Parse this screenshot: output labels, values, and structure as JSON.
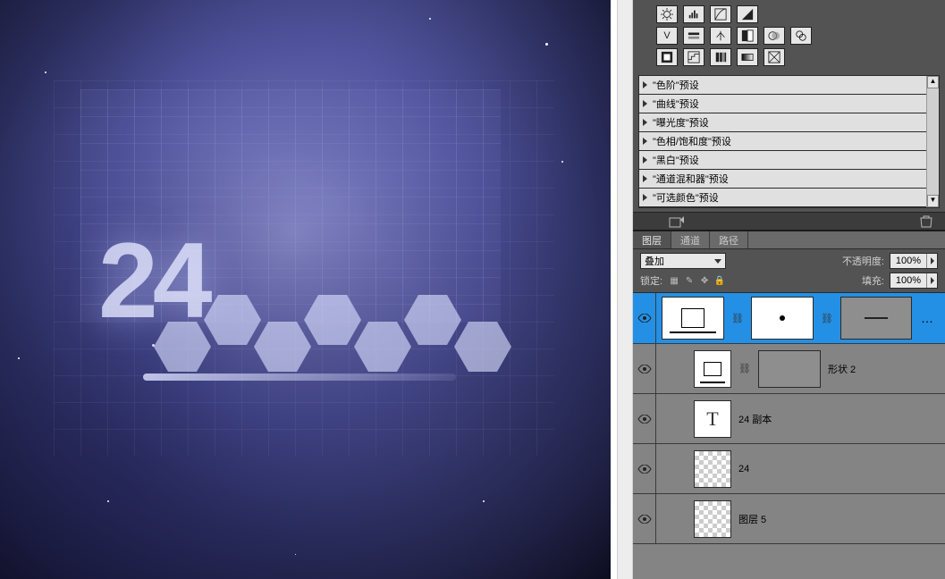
{
  "canvas": {
    "text": "24"
  },
  "presets": {
    "items": [
      {
        "label": "\"色阶\"预设"
      },
      {
        "label": "\"曲线\"预设"
      },
      {
        "label": "\"曝光度\"预设"
      },
      {
        "label": "\"色相/饱和度\"预设"
      },
      {
        "label": "\"黑白\"预设"
      },
      {
        "label": "\"通道混和器\"预设"
      },
      {
        "label": "\"可选颜色\"预设"
      }
    ]
  },
  "layers_panel": {
    "tabs": {
      "layers": "图层",
      "channels": "通道",
      "paths": "路径"
    },
    "blend_mode": "叠加",
    "opacity_label": "不透明度:",
    "opacity_value": "100%",
    "lock_label": "锁定:",
    "fill_label": "填充:",
    "fill_value": "100%",
    "layers": [
      {
        "name": "",
        "selected": true,
        "type": "adjustment"
      },
      {
        "name": "形状 2",
        "selected": false,
        "type": "shape"
      },
      {
        "name": "24 副本",
        "selected": false,
        "type": "text"
      },
      {
        "name": "24",
        "selected": false,
        "type": "raster-trans"
      },
      {
        "name": "图层 5",
        "selected": false,
        "type": "raster-smoke"
      }
    ]
  }
}
